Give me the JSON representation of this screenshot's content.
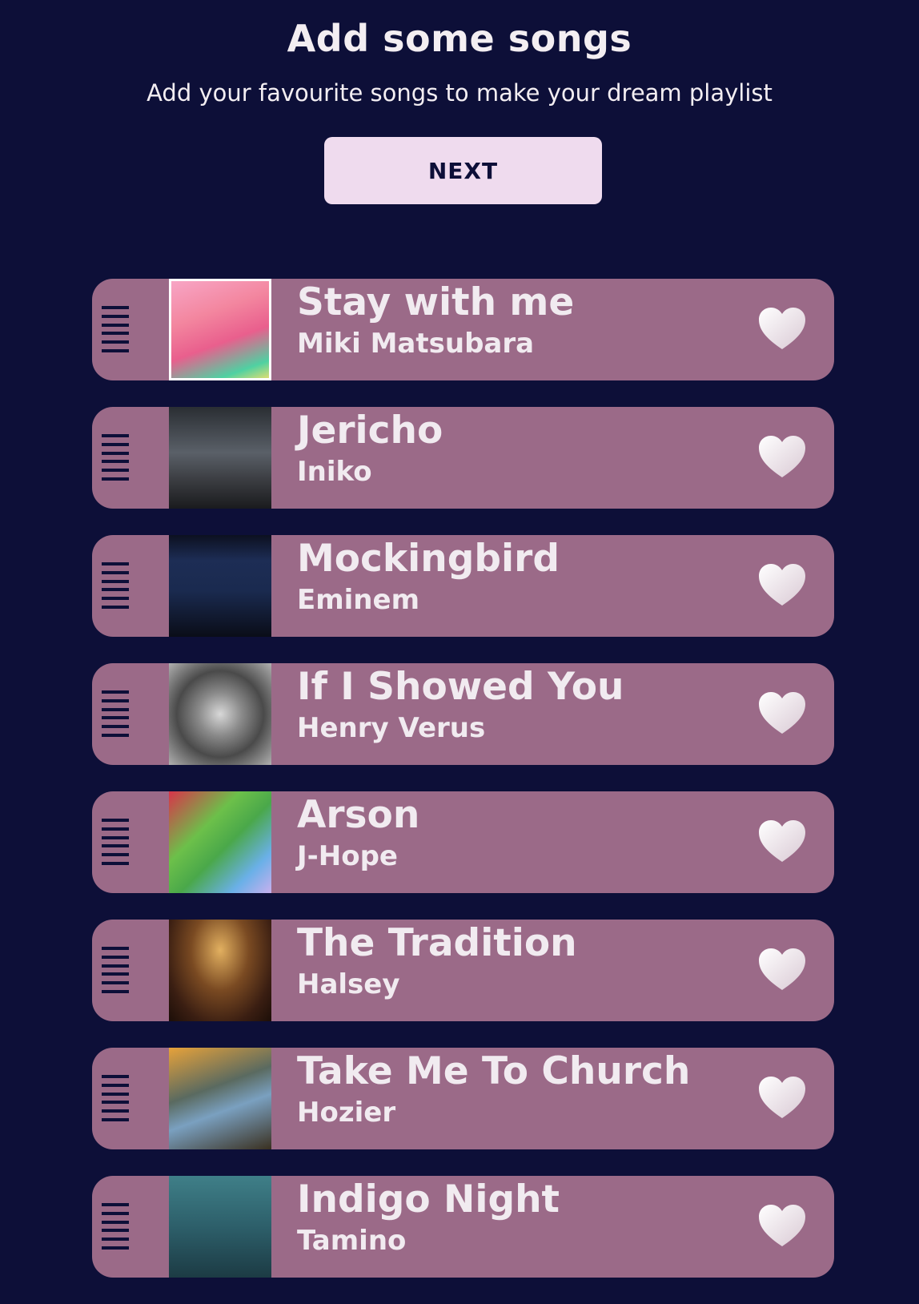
{
  "header": {
    "title": "Add some songs",
    "subtitle": "Add your favourite songs to make your dream playlist",
    "next_label": "NEXT"
  },
  "songs": [
    {
      "title": "Stay with me",
      "artist": "Miki Matsubara"
    },
    {
      "title": "Jericho",
      "artist": "Iniko"
    },
    {
      "title": "Mockingbird",
      "artist": "Eminem"
    },
    {
      "title": "If I Showed You",
      "artist": "Henry Verus"
    },
    {
      "title": "Arson",
      "artist": "J-Hope"
    },
    {
      "title": "The Tradition",
      "artist": "Halsey"
    },
    {
      "title": "Take Me To Church",
      "artist": "Hozier"
    },
    {
      "title": "Indigo Night",
      "artist": "Tamino"
    }
  ],
  "colors": {
    "background": "#0d0f38",
    "row": "#9b6a88",
    "button": "#efdbee",
    "text": "#f1ebf0"
  },
  "icons": {
    "drag": "drag-handle-icon",
    "favourite": "heart-icon"
  }
}
